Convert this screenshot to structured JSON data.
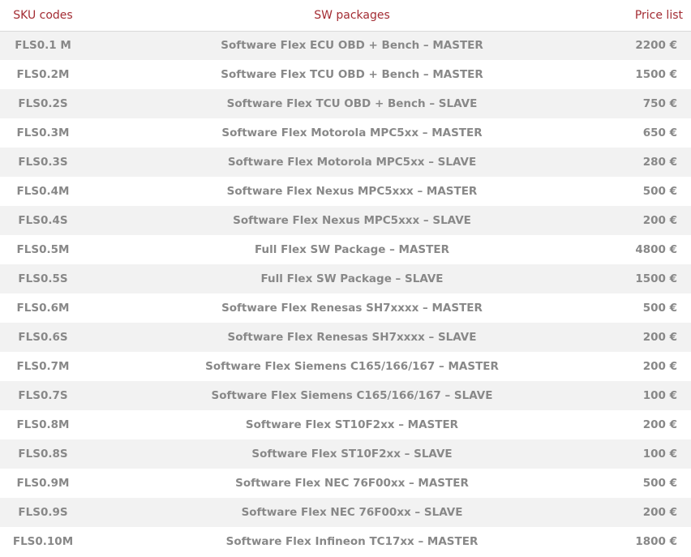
{
  "headers": {
    "sku": "SKU codes",
    "package": "SW packages",
    "price": "Price list"
  },
  "colors": {
    "header_text": "#a32c33",
    "body_text": "#888888",
    "row_stripe": "#f2f2f2"
  },
  "rows": [
    {
      "sku": "FLS0.1 M",
      "package": "Software Flex ECU OBD + Bench – MASTER",
      "price": "2200 €"
    },
    {
      "sku": "FLS0.2M",
      "package": "Software Flex TCU OBD + Bench – MASTER",
      "price": "1500 €"
    },
    {
      "sku": "FLS0.2S",
      "package": "Software Flex TCU OBD + Bench – SLAVE",
      "price": "750 €"
    },
    {
      "sku": "FLS0.3M",
      "package": "Software Flex Motorola MPC5xx – MASTER",
      "price": "650 €"
    },
    {
      "sku": "FLS0.3S",
      "package": "Software Flex Motorola MPC5xx – SLAVE",
      "price": "280 €"
    },
    {
      "sku": "FLS0.4M",
      "package": "Software Flex Nexus MPC5xxx – MASTER",
      "price": "500 €"
    },
    {
      "sku": "FLS0.4S",
      "package": "Software Flex Nexus MPC5xxx – SLAVE",
      "price": "200 €"
    },
    {
      "sku": "FLS0.5M",
      "package": "Full Flex SW Package – MASTER",
      "price": "4800 €"
    },
    {
      "sku": "FLS0.5S",
      "package": "Full Flex SW Package – SLAVE",
      "price": "1500 €"
    },
    {
      "sku": "FLS0.6M",
      "package": "Software Flex Renesas SH7xxxx – MASTER",
      "price": "500 €"
    },
    {
      "sku": "FLS0.6S",
      "package": "Software Flex Renesas SH7xxxx – SLAVE",
      "price": "200 €"
    },
    {
      "sku": "FLS0.7M",
      "package": "Software Flex Siemens C165/166/167 – MASTER",
      "price": "200 €"
    },
    {
      "sku": "FLS0.7S",
      "package": "Software Flex Siemens C165/166/167 – SLAVE",
      "price": "100 €"
    },
    {
      "sku": "FLS0.8M",
      "package": "Software Flex ST10F2xx – MASTER",
      "price": "200 €"
    },
    {
      "sku": "FLS0.8S",
      "package": "Software Flex ST10F2xx – SLAVE",
      "price": "100 €"
    },
    {
      "sku": "FLS0.9M",
      "package": "Software Flex NEC 76F00xx – MASTER",
      "price": "500 €"
    },
    {
      "sku": "FLS0.9S",
      "package": "Software Flex NEC 76F00xx – SLAVE",
      "price": "200 €"
    },
    {
      "sku": "FLS0.10M",
      "package": "Software Flex Infineon TC17xx – MASTER",
      "price": "1800 €"
    }
  ]
}
